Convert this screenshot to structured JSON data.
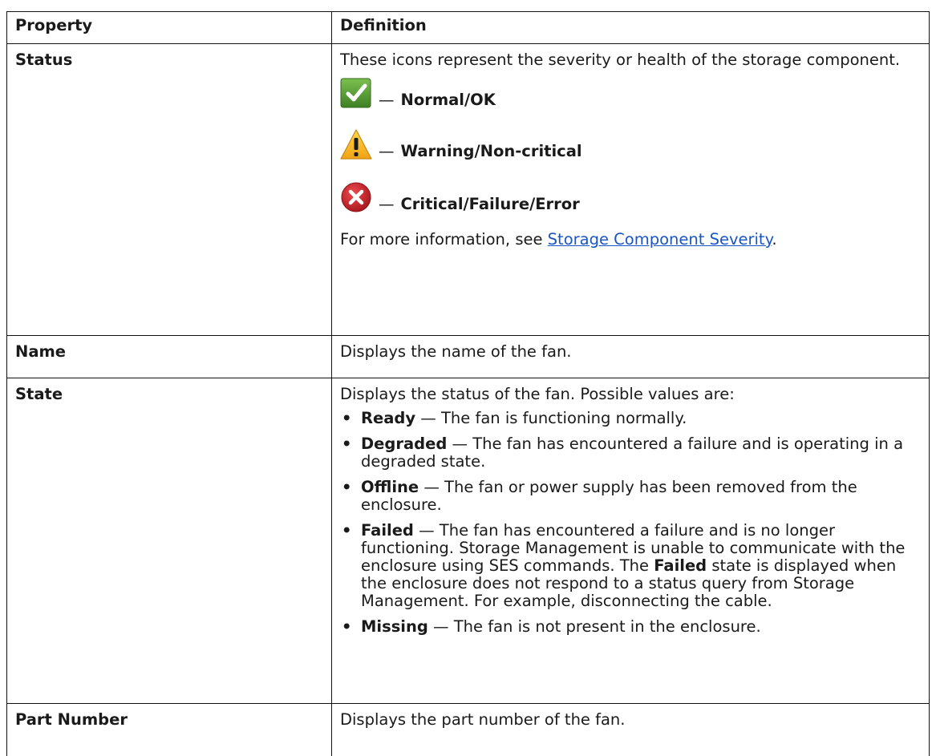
{
  "table": {
    "header": {
      "col1": "Property",
      "col2": "Definition"
    },
    "status": {
      "property": "Status",
      "intro": "These icons represent the severity or health of the storage component.",
      "severities": [
        {
          "icon": "check-icon",
          "dash": "—",
          "label": "Normal/OK",
          "color": "#4a8a2c"
        },
        {
          "icon": "warning-icon",
          "dash": "—",
          "label": "Warning/Non-critical",
          "color": "#f2b21c"
        },
        {
          "icon": "error-icon",
          "dash": "—",
          "label": "Critical/Failure/Error",
          "color": "#c8262c"
        }
      ],
      "more_prefix": "For more information, see ",
      "more_link": "Storage Component Severity",
      "more_suffix": "."
    },
    "name": {
      "property": "Name",
      "definition": "Displays the name of the fan."
    },
    "state": {
      "property": "State",
      "intro": "Displays the status of the fan. Possible values are:",
      "items": [
        {
          "term": "Ready",
          "dash": " — ",
          "text": "The fan is functioning normally."
        },
        {
          "term": "Degraded",
          "dash": " — ",
          "text": "The fan has encountered a failure and is operating in a degraded state."
        },
        {
          "term": "Offline",
          "dash": " — ",
          "text": "The fan or power supply has been removed from the enclosure."
        },
        {
          "term": "Failed",
          "dash": " — ",
          "text": "The fan has encountered a failure and is no longer functioning. Storage Management is unable to communicate with the enclosure using SES commands. The ",
          "term2": "Failed",
          "text2": " state is displayed when the enclosure does not respond to a status query from Storage Management. For example, disconnecting the cable."
        },
        {
          "term": "Missing",
          "dash": " — ",
          "text": "The fan is not present in the enclosure."
        }
      ]
    },
    "part_number": {
      "property": "Part Number",
      "definition": "Displays the part number of the fan."
    }
  }
}
